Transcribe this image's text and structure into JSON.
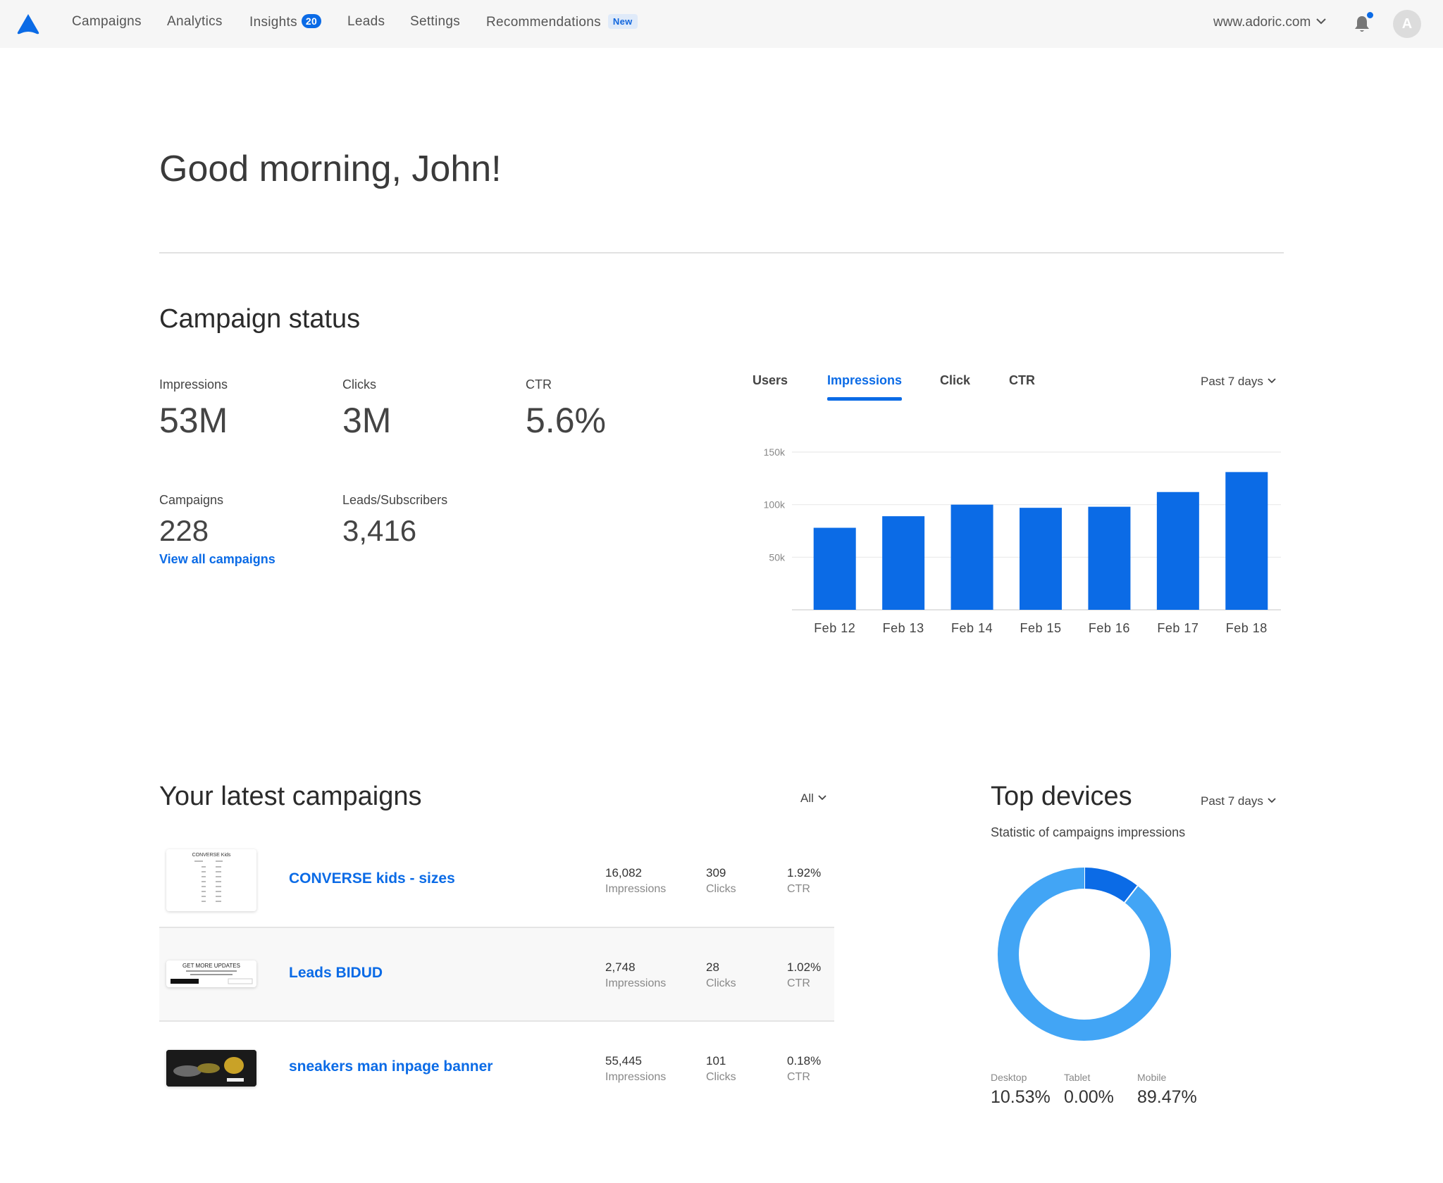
{
  "nav": {
    "items": [
      {
        "label": "Campaigns"
      },
      {
        "label": "Analytics"
      },
      {
        "label": "Insights",
        "badge": "20"
      },
      {
        "label": "Leads"
      },
      {
        "label": "Settings"
      },
      {
        "label": "Recommendations",
        "tag": "New"
      }
    ],
    "site": "www.adoric.com",
    "avatar_initial": "A"
  },
  "greeting": "Good morning, John!",
  "campaign_status": {
    "title": "Campaign status",
    "impressions": {
      "label": "Impressions",
      "value": "53M"
    },
    "clicks": {
      "label": "Clicks",
      "value": "3M"
    },
    "ctr": {
      "label": "CTR",
      "value": "5.6%"
    },
    "campaigns": {
      "label": "Campaigns",
      "value": "228"
    },
    "leads": {
      "label": "Leads/Subscribers",
      "value": "3,416"
    },
    "view_all": "View all campaigns"
  },
  "chart_tabs": {
    "users": "Users",
    "impressions": "Impressions",
    "click": "Click",
    "ctr": "CTR",
    "active": "Impressions",
    "range": "Past 7 days"
  },
  "chart_data": {
    "type": "bar",
    "categories": [
      "Feb 12",
      "Feb 13",
      "Feb 14",
      "Feb 15",
      "Feb 16",
      "Feb 17",
      "Feb 18"
    ],
    "values": [
      78000,
      89000,
      100000,
      97000,
      98000,
      112000,
      131000
    ],
    "title": "",
    "xlabel": "",
    "ylabel": "",
    "yticks": [
      "50k",
      "100k",
      "150k"
    ],
    "ylim": [
      0,
      150000
    ],
    "grid": true,
    "color": "#0b6be6"
  },
  "latest": {
    "title": "Your latest campaigns",
    "filter": "All",
    "campaigns": [
      {
        "name": "CONVERSE kids - sizes",
        "impressions": "16,082",
        "clicks": "309",
        "ctr": "1.92%",
        "imp_label": "Impressions",
        "clk_label": "Clicks",
        "ctr_label": "CTR",
        "thumb_text": "CONVERSE Kids"
      },
      {
        "name": "Leads BIDUD",
        "impressions": "2,748",
        "clicks": "28",
        "ctr": "1.02%",
        "imp_label": "Impressions",
        "clk_label": "Clicks",
        "ctr_label": "CTR",
        "thumb_text": "GET MORE UPDATES"
      },
      {
        "name": "sneakers man inpage banner",
        "impressions": "55,445",
        "clicks": "101",
        "ctr": "0.18%",
        "imp_label": "Impressions",
        "clk_label": "Clicks",
        "ctr_label": "CTR"
      }
    ]
  },
  "devices": {
    "title": "Top devices",
    "range": "Past 7 days",
    "subtitle": "Statistic of campaigns impressions",
    "items": [
      {
        "label": "Desktop",
        "value": "10.53%",
        "pct": 10.53,
        "color": "#0b6be6"
      },
      {
        "label": "Tablet",
        "value": "0.00%",
        "pct": 0.0,
        "color": "#0b6be6"
      },
      {
        "label": "Mobile",
        "value": "89.47%",
        "pct": 89.47,
        "color": "#42a5f5"
      }
    ]
  }
}
